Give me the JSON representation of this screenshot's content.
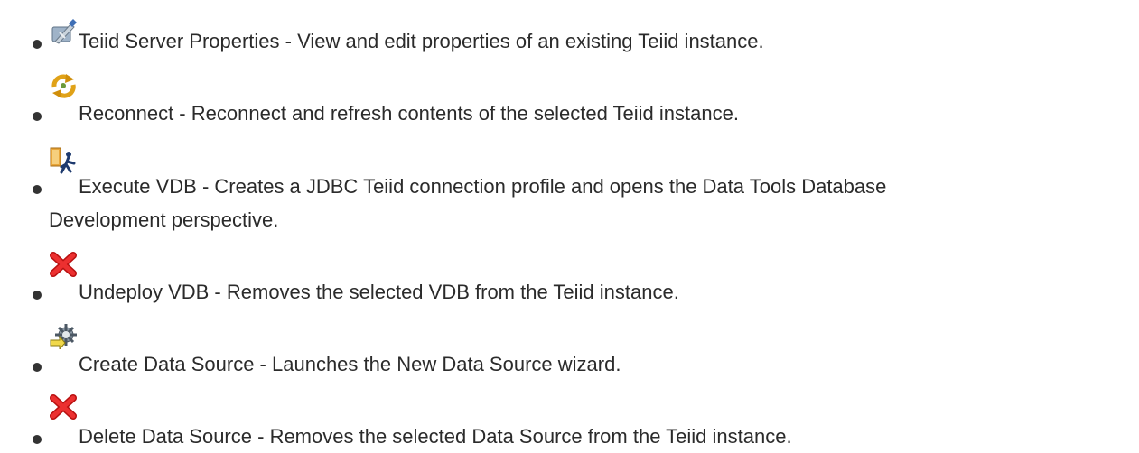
{
  "items": [
    {
      "icon": "teiid-server-properties-icon",
      "name": "Teiid Server Properties",
      "description": "View and edit properties of an existing Teiid instance."
    },
    {
      "icon": "reconnect-icon",
      "name": "Reconnect",
      "description": "Reconnect and refresh contents of the selected Teiid instance."
    },
    {
      "icon": "execute-vdb-icon",
      "name": "Execute VDB",
      "description": "Creates a JDBC Teiid connection profile and opens the Data Tools Database",
      "description_cont": "Development perspective."
    },
    {
      "icon": "undeploy-vdb-icon",
      "name": "Undeploy VDB",
      "description": "Removes the selected VDB from the Teiid instance."
    },
    {
      "icon": "create-data-source-icon",
      "name": "Create Data Source",
      "description": "Launches the New Data Source wizard."
    },
    {
      "icon": "delete-data-source-icon",
      "name": "Delete Data Source",
      "description": "Removes the selected Data Source from the Teiid instance."
    }
  ],
  "separator": " - "
}
